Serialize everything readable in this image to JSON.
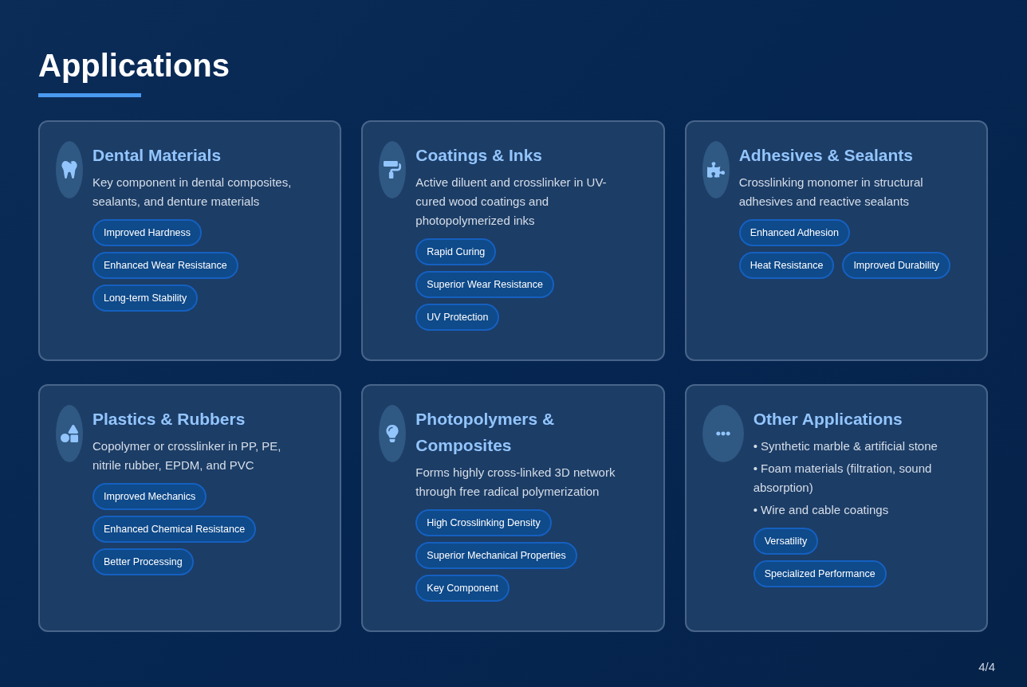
{
  "title": "Applications",
  "cards": [
    {
      "title": "Dental Materials",
      "description": "Key component in dental composites, sealants, and denture materials",
      "tags": [
        "Improved Hardness",
        "Enhanced Wear Resistance",
        "Long-term Stability"
      ]
    },
    {
      "title": "Coatings & Inks",
      "description": "Active diluent and crosslinker in UV-cured wood coatings and photopolymerized inks",
      "tags": [
        "Rapid Curing",
        "Superior Wear Resistance",
        "UV Protection"
      ]
    },
    {
      "title": "Adhesives & Sealants",
      "description": "Crosslinking monomer in structural adhesives and reactive sealants",
      "tags": [
        "Enhanced Adhesion",
        "Heat Resistance",
        "Improved Durability"
      ]
    },
    {
      "title": "Plastics & Rubbers",
      "description": "Copolymer or crosslinker in PP, PE, nitrile rubber, EPDM, and PVC",
      "tags": [
        "Improved Mechanics",
        "Enhanced Chemical Resistance",
        "Better Processing"
      ]
    },
    {
      "title": "Photopolymers & Composites",
      "description": "Forms highly cross-linked 3D network through free radical polymerization",
      "tags": [
        "High Crosslinking Density",
        "Superior Mechanical Properties",
        "Key Component"
      ]
    },
    {
      "title": "Other Applications",
      "bullets": [
        "• Synthetic marble & artificial stone",
        "• Foam materials (filtration, sound absorption)",
        "• Wire and cable coatings"
      ],
      "tags": [
        "Versatility",
        "Specialized Performance"
      ]
    }
  ],
  "page_number": "4/4"
}
